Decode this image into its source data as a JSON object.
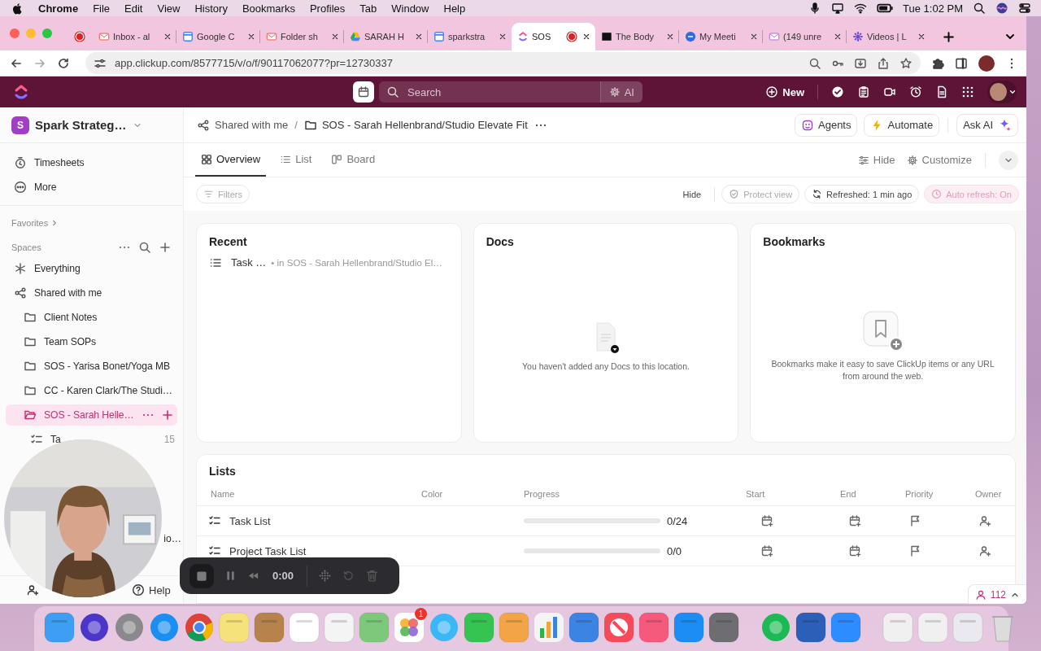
{
  "menu_bar": {
    "app_name": "Chrome",
    "menus": [
      "File",
      "Edit",
      "View",
      "History",
      "Bookmarks",
      "Profiles",
      "Tab",
      "Window",
      "Help"
    ],
    "clock": "Tue 1:02 PM"
  },
  "browser": {
    "tabs": [
      {
        "title": "Inbox - al",
        "selected": false,
        "recording": false
      },
      {
        "title": "Google C",
        "selected": false,
        "recording": false
      },
      {
        "title": "Folder sh",
        "selected": false,
        "recording": false
      },
      {
        "title": "SARAH H",
        "selected": false,
        "recording": false
      },
      {
        "title": "sparkstra",
        "selected": false,
        "recording": false
      },
      {
        "title": "SOS",
        "selected": true,
        "recording": true
      },
      {
        "title": "The Body",
        "selected": false,
        "recording": false
      },
      {
        "title": "My Meeti",
        "selected": false,
        "recording": false
      },
      {
        "title": "(149 unre",
        "selected": false,
        "recording": false
      },
      {
        "title": "Videos | L",
        "selected": false,
        "recording": false
      }
    ],
    "url": "app.clickup.com/8577715/v/o/f/90117062077?pr=12730337"
  },
  "top_bar": {
    "search": {
      "placeholder": "Search"
    },
    "ai_button": "AI",
    "new_button": "New"
  },
  "sidebar": {
    "workspace": {
      "initial": "S",
      "name": "Spark Strateg…"
    },
    "nav": [
      {
        "kind": "timesheets",
        "label": "Timesheets"
      },
      {
        "kind": "more",
        "label": "More"
      }
    ],
    "favorites_label": "Favorites",
    "spaces_label": "Spaces",
    "tree": [
      {
        "kind": "everything",
        "label": "Everything",
        "selected": false
      },
      {
        "kind": "shared",
        "label": "Shared with me",
        "selected": false,
        "children": [
          {
            "kind": "folder",
            "label": "Client Notes",
            "selected": false
          },
          {
            "kind": "folder",
            "label": "Team SOPs",
            "selected": false
          },
          {
            "kind": "folder",
            "label": "SOS - Yarisa Bonet/Yoga MB",
            "selected": false
          },
          {
            "kind": "folder",
            "label": "CC - Karen Clark/The Studi…",
            "selected": false
          },
          {
            "kind": "folder",
            "label": "SOS - Sarah Helle…",
            "selected": true,
            "children": [
              {
                "kind": "list",
                "label": "Ta",
                "count": "15",
                "selected": false
              }
            ]
          }
        ]
      }
    ],
    "hidden_row_tail": "io…",
    "help_button": "Help"
  },
  "header": {
    "breadcrumb": [
      {
        "kind": "shared",
        "label": "Shared with me"
      },
      {
        "kind": "folder",
        "label": "SOS - Sarah Hellenbrand/Studio Elevate Fit"
      }
    ],
    "separator": "/",
    "buttons": [
      {
        "kind": "agents",
        "label": "Agents"
      },
      {
        "kind": "automate",
        "label": "Automate"
      },
      {
        "kind": "askai",
        "label": "Ask AI"
      }
    ]
  },
  "view_tabs": [
    {
      "kind": "overview",
      "label": "Overview",
      "selected": true
    },
    {
      "kind": "list",
      "label": "List",
      "selected": false
    },
    {
      "kind": "board",
      "label": "Board",
      "selected": false
    }
  ],
  "view_actions": {
    "hide": "Hide",
    "customize": "Customize"
  },
  "toolbar": {
    "filters": "Filters",
    "hide": "Hide",
    "protect_view": "Protect view",
    "refreshed": "Refreshed: 1 min ago",
    "auto_refresh": "Auto refresh: On"
  },
  "cards": [
    {
      "kind": "recent",
      "title": "Recent",
      "items": [
        {
          "name": "Task …",
          "location": "• in SOS - Sarah Hellenbrand/Studio El…"
        }
      ]
    },
    {
      "kind": "docs",
      "title": "Docs",
      "message": "You haven't added any Docs to this location."
    },
    {
      "kind": "bookmarks",
      "title": "Bookmarks",
      "message": "Bookmarks make it easy to save ClickUp items or any URL from around the web."
    }
  ],
  "lists": {
    "title": "Lists",
    "columns": [
      "Name",
      "Color",
      "Progress",
      "Start",
      "End",
      "Priority",
      "Owner"
    ],
    "rows": [
      {
        "name": "Task List",
        "level": 0,
        "progress": "0/24"
      },
      {
        "name": "Project Task List",
        "level": 0,
        "progress": "0/0"
      }
    ]
  },
  "notifications": {
    "count": "112"
  },
  "recorder": {
    "time": "0:00"
  },
  "dock": {
    "badge": "1"
  }
}
